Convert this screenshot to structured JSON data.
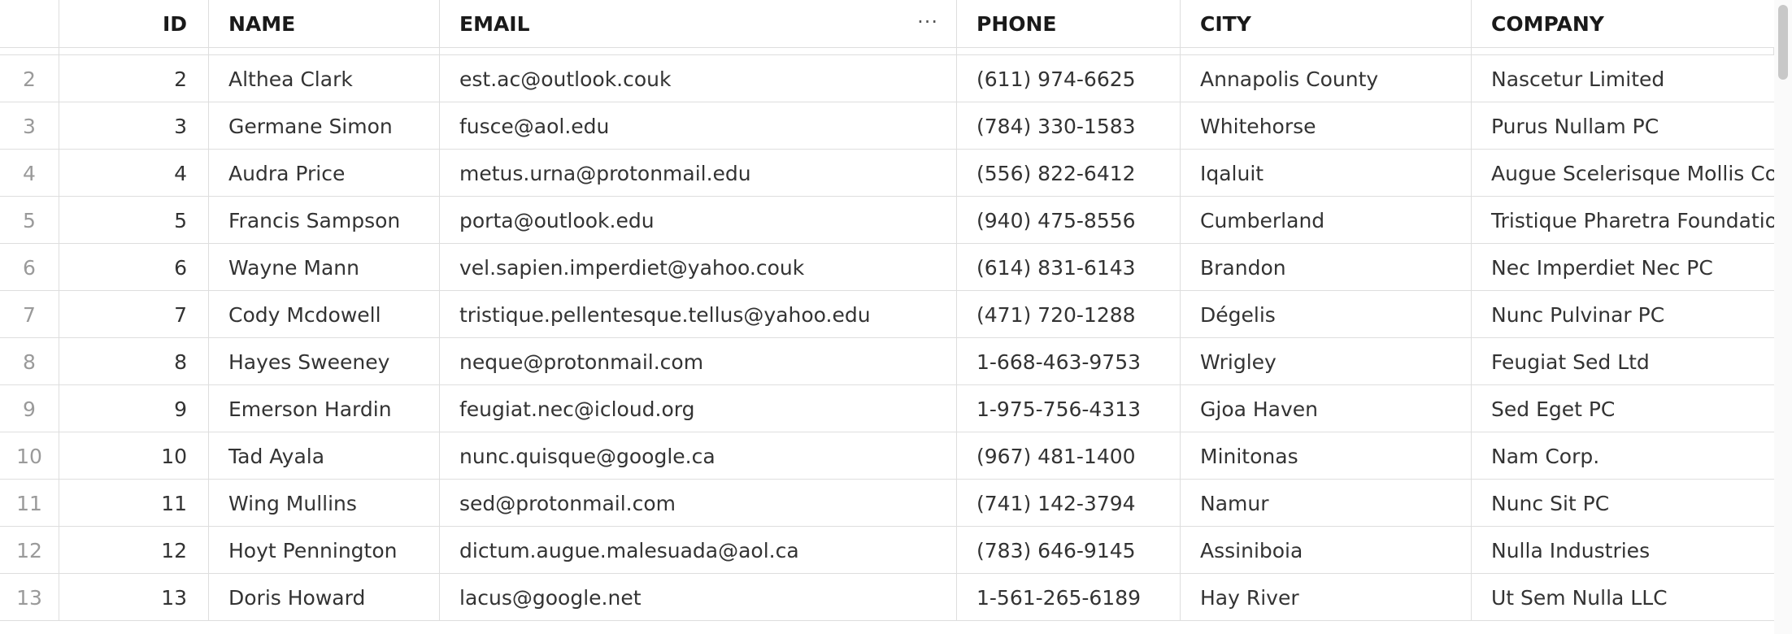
{
  "columns": {
    "rownum": "",
    "id": "ID",
    "name": "NAME",
    "email": "EMAIL",
    "phone": "PHONE",
    "city": "CITY",
    "company": "COMPANY"
  },
  "icons": {
    "column_menu": "more-horizontal-icon"
  },
  "rows": [
    {
      "rownum": "2",
      "id": "2",
      "name": "Althea Clark",
      "email": "est.ac@outlook.couk",
      "phone": "(611) 974-6625",
      "city": "Annapolis County",
      "company": "Nascetur Limited"
    },
    {
      "rownum": "3",
      "id": "3",
      "name": "Germane Simon",
      "email": "fusce@aol.edu",
      "phone": "(784) 330-1583",
      "city": "Whitehorse",
      "company": "Purus Nullam PC"
    },
    {
      "rownum": "4",
      "id": "4",
      "name": "Audra Price",
      "email": "metus.urna@protonmail.edu",
      "phone": "(556) 822-6412",
      "city": "Iqaluit",
      "company": "Augue Scelerisque Mollis Co"
    },
    {
      "rownum": "5",
      "id": "5",
      "name": "Francis Sampson",
      "email": "porta@outlook.edu",
      "phone": "(940) 475-8556",
      "city": "Cumberland",
      "company": "Tristique Pharetra Foundatio"
    },
    {
      "rownum": "6",
      "id": "6",
      "name": "Wayne Mann",
      "email": "vel.sapien.imperdiet@yahoo.couk",
      "phone": "(614) 831-6143",
      "city": "Brandon",
      "company": "Nec Imperdiet Nec PC"
    },
    {
      "rownum": "7",
      "id": "7",
      "name": "Cody Mcdowell",
      "email": "tristique.pellentesque.tellus@yahoo.edu",
      "phone": "(471) 720-1288",
      "city": "Dégelis",
      "company": "Nunc Pulvinar PC"
    },
    {
      "rownum": "8",
      "id": "8",
      "name": "Hayes Sweeney",
      "email": "neque@protonmail.com",
      "phone": "1-668-463-9753",
      "city": "Wrigley",
      "company": "Feugiat Sed Ltd"
    },
    {
      "rownum": "9",
      "id": "9",
      "name": "Emerson Hardin",
      "email": "feugiat.nec@icloud.org",
      "phone": "1-975-756-4313",
      "city": "Gjoa Haven",
      "company": "Sed Eget PC"
    },
    {
      "rownum": "10",
      "id": "10",
      "name": "Tad Ayala",
      "email": "nunc.quisque@google.ca",
      "phone": "(967) 481-1400",
      "city": "Minitonas",
      "company": "Nam Corp."
    },
    {
      "rownum": "11",
      "id": "11",
      "name": "Wing Mullins",
      "email": "sed@protonmail.com",
      "phone": "(741) 142-3794",
      "city": "Namur",
      "company": "Nunc Sit PC"
    },
    {
      "rownum": "12",
      "id": "12",
      "name": "Hoyt Pennington",
      "email": "dictum.augue.malesuada@aol.ca",
      "phone": "(783) 646-9145",
      "city": "Assiniboia",
      "company": "Nulla Industries"
    },
    {
      "rownum": "13",
      "id": "13",
      "name": "Doris Howard",
      "email": "lacus@google.net",
      "phone": "1-561-265-6189",
      "city": "Hay River",
      "company": "Ut Sem Nulla LLC"
    }
  ]
}
